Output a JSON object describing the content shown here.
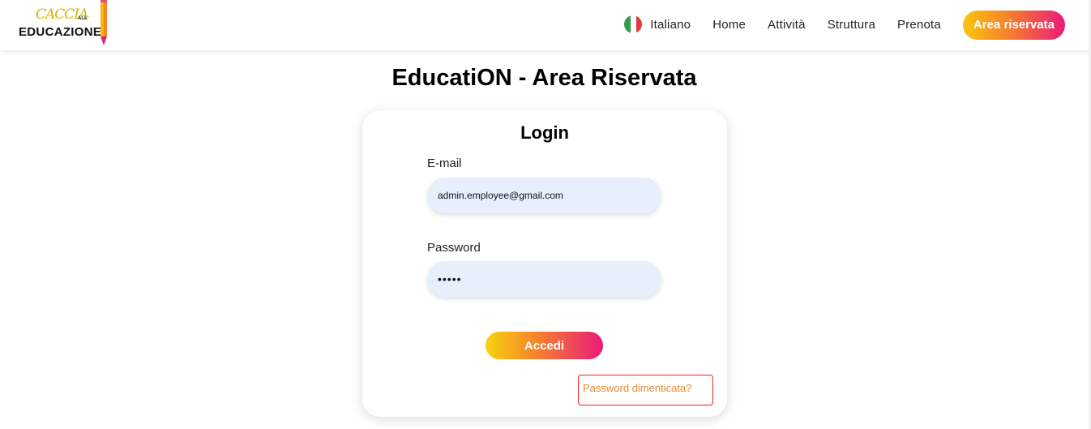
{
  "brand": {
    "logo_top": "CACCIA",
    "logo_all": "ALL'",
    "logo_bottom": "EDUCAZIONE"
  },
  "nav": {
    "language": "Italiano",
    "items": [
      {
        "label": "Home"
      },
      {
        "label": "Attività"
      },
      {
        "label": "Struttura"
      },
      {
        "label": "Prenota"
      }
    ],
    "cta": "Area riservata"
  },
  "page": {
    "title": "EducatiON - Area Riservata"
  },
  "login": {
    "title": "Login",
    "email_label": "E-mail",
    "email_value": "admin.employee@gmail.com",
    "password_label": "Password",
    "password_value": "•••••",
    "submit_label": "Accedi",
    "forgot_label": "Password dimenticata?"
  },
  "colors": {
    "accent_start": "#f9c60f",
    "accent_mid": "#f6802d",
    "accent_end": "#ea1a7a",
    "link": "#e88a2e",
    "input_bg": "#e8effc"
  }
}
